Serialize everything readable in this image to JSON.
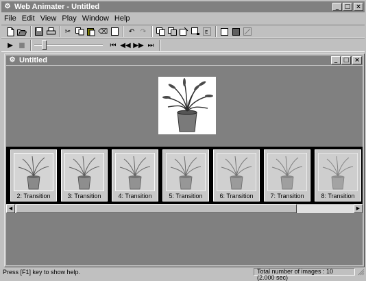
{
  "app": {
    "title": "Web Animater - Untitled",
    "icon": "app-icon"
  },
  "window_controls": {
    "minimize": "_",
    "maximize": "□",
    "close": "×"
  },
  "menu": [
    {
      "label": "File"
    },
    {
      "label": "Edit"
    },
    {
      "label": "View"
    },
    {
      "label": "Play"
    },
    {
      "label": "Window"
    },
    {
      "label": "Help"
    }
  ],
  "toolbar": {
    "file_icons": [
      "new-file-icon",
      "open-folder-icon",
      "save-icon"
    ],
    "edit_icons": [
      "cut-icon",
      "copy-icon",
      "paste-icon",
      "delete-icon",
      "clear-icon"
    ],
    "history_icons": [
      "undo-icon",
      "redo-icon"
    ],
    "frame_icons": [
      "insert-frame-icon",
      "append-frame-icon",
      "frame-properties-icon",
      "transition-icon",
      "effects-icon"
    ],
    "view_icons": [
      "view-normal-icon",
      "view-thumbnail-icon",
      "disabled-tool-icon"
    ]
  },
  "playback": {
    "play": "▶",
    "stop": "■",
    "slider_position": 0.12,
    "first": "⏮",
    "prev": "◀◀",
    "next": "▶▶",
    "last": "⏭"
  },
  "document": {
    "title": "Untitled"
  },
  "filmstrip": {
    "frames": [
      {
        "label": "2: Transition"
      },
      {
        "label": "3: Transition"
      },
      {
        "label": "4: Transition"
      },
      {
        "label": "5: Transition"
      },
      {
        "label": "6: Transition"
      },
      {
        "label": "7: Transition"
      },
      {
        "label": "8: Transition"
      }
    ]
  },
  "status": {
    "help": "Press [F1] key to show help.",
    "count": "Total number of images : 10 (2.000 sec)"
  },
  "colors": {
    "face": "#c0c0c0",
    "titlebar": "#808080",
    "workspace": "#808080",
    "filmstrip_bg": "#000000"
  }
}
